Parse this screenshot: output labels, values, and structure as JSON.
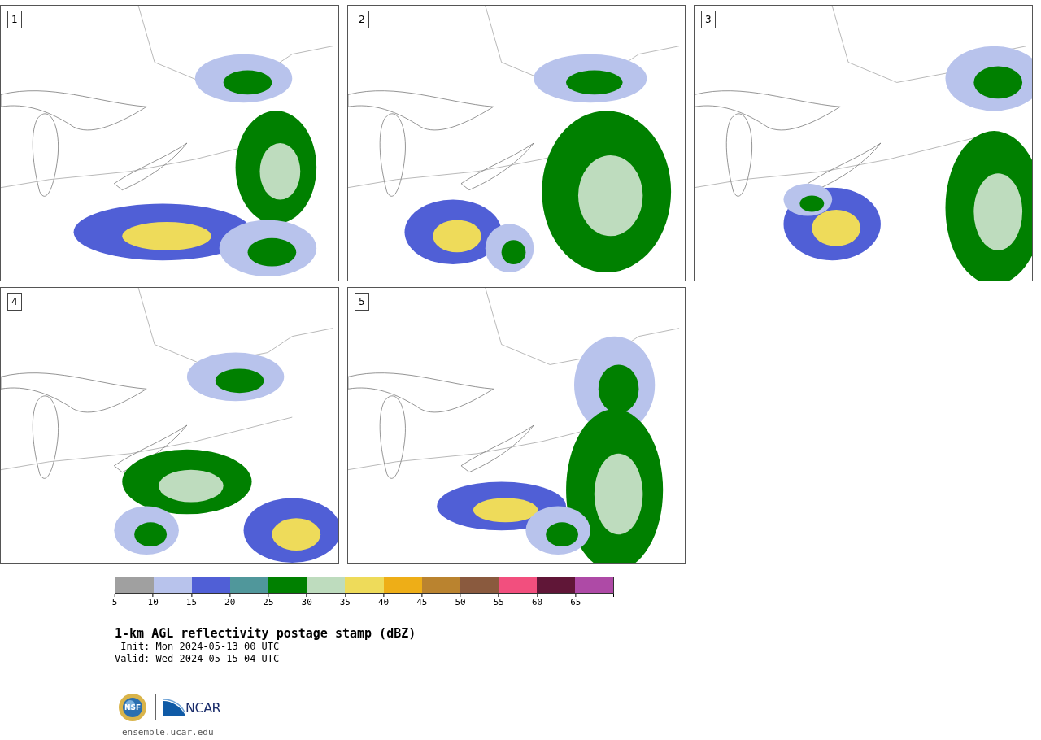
{
  "panels": [
    {
      "label": "1"
    },
    {
      "label": "2"
    },
    {
      "label": "3"
    },
    {
      "label": "4"
    },
    {
      "label": "5"
    }
  ],
  "colorbar": {
    "bins": [
      {
        "color": "#a0a0a0"
      },
      {
        "color": "#b8c3ec"
      },
      {
        "color": "#505fd6"
      },
      {
        "color": "#50979b"
      },
      {
        "color": "#008000"
      },
      {
        "color": "#bedcbe"
      },
      {
        "color": "#eedb5a"
      },
      {
        "color": "#eeae17"
      },
      {
        "color": "#ba832f"
      },
      {
        "color": "#8a5a3e"
      },
      {
        "color": "#f24f7e"
      },
      {
        "color": "#601637"
      },
      {
        "color": "#ae4aa6"
      }
    ],
    "ticks": [
      "5",
      "10",
      "15",
      "20",
      "25",
      "30",
      "35",
      "40",
      "45",
      "50",
      "55",
      "60",
      "65"
    ]
  },
  "title": "1-km AGL reflectivity postage stamp (dBZ)",
  "init": " Init: Mon 2024-05-13 00 UTC",
  "valid": "Valid: Wed 2024-05-15 04 UTC",
  "logos": {
    "nsf": "NSF",
    "ncar": "NCAR"
  },
  "url": "ensemble.ucar.edu"
}
